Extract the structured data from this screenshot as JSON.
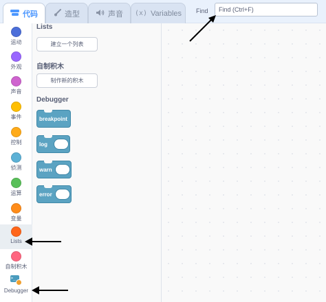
{
  "tabs": [
    {
      "label": "代码",
      "icon": "code-icon"
    },
    {
      "label": "造型",
      "icon": "brush-icon"
    },
    {
      "label": "声音",
      "icon": "speaker-icon"
    },
    {
      "label": "Variables",
      "icon": "variables-icon"
    }
  ],
  "find": {
    "label": "Find",
    "placeholder": "Find (Ctrl+F)"
  },
  "categories": [
    {
      "label": "运动",
      "color": "#4c6ed9"
    },
    {
      "label": "外观",
      "color": "#9966ff"
    },
    {
      "label": "声音",
      "color": "#cf63cf"
    },
    {
      "label": "事件",
      "color": "#ffbf00"
    },
    {
      "label": "控制",
      "color": "#ffab19"
    },
    {
      "label": "侦测",
      "color": "#5cb1d6"
    },
    {
      "label": "运算",
      "color": "#59c059"
    },
    {
      "label": "变量",
      "color": "#ff8c1a"
    },
    {
      "label": "Lists",
      "color": "#ff661a"
    },
    {
      "label": "自制积木",
      "color": "#ff6680"
    },
    {
      "label": "Debugger",
      "icon": "debugger-icon"
    }
  ],
  "palette": {
    "lists_title": "Lists",
    "make_list_button": "建立一个列表",
    "my_blocks_title": "自制积木",
    "make_block_button": "制作新的积木",
    "debugger_title": "Debugger",
    "blocks": [
      "breakpoint",
      "log",
      "warn",
      "error"
    ]
  },
  "colors": {
    "accent": "#4c97ff",
    "debugger_block": "#5ba3c2",
    "annotation_arrow": "#000000"
  }
}
